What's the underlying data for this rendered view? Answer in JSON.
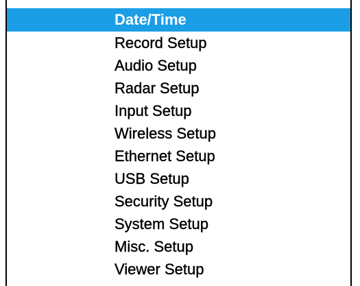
{
  "colors": {
    "selection_background": "#1a9ee6",
    "selection_text": "#ffffff",
    "text": "#000000",
    "background": "#ffffff"
  },
  "menu": {
    "selected_index": 0,
    "items": [
      {
        "label": "Date/Time"
      },
      {
        "label": "Record Setup"
      },
      {
        "label": "Audio Setup"
      },
      {
        "label": "Radar Setup"
      },
      {
        "label": "Input Setup"
      },
      {
        "label": "Wireless Setup"
      },
      {
        "label": "Ethernet Setup"
      },
      {
        "label": "USB Setup"
      },
      {
        "label": "Security Setup"
      },
      {
        "label": "System Setup"
      },
      {
        "label": "Misc. Setup"
      },
      {
        "label": "Viewer Setup"
      }
    ]
  }
}
